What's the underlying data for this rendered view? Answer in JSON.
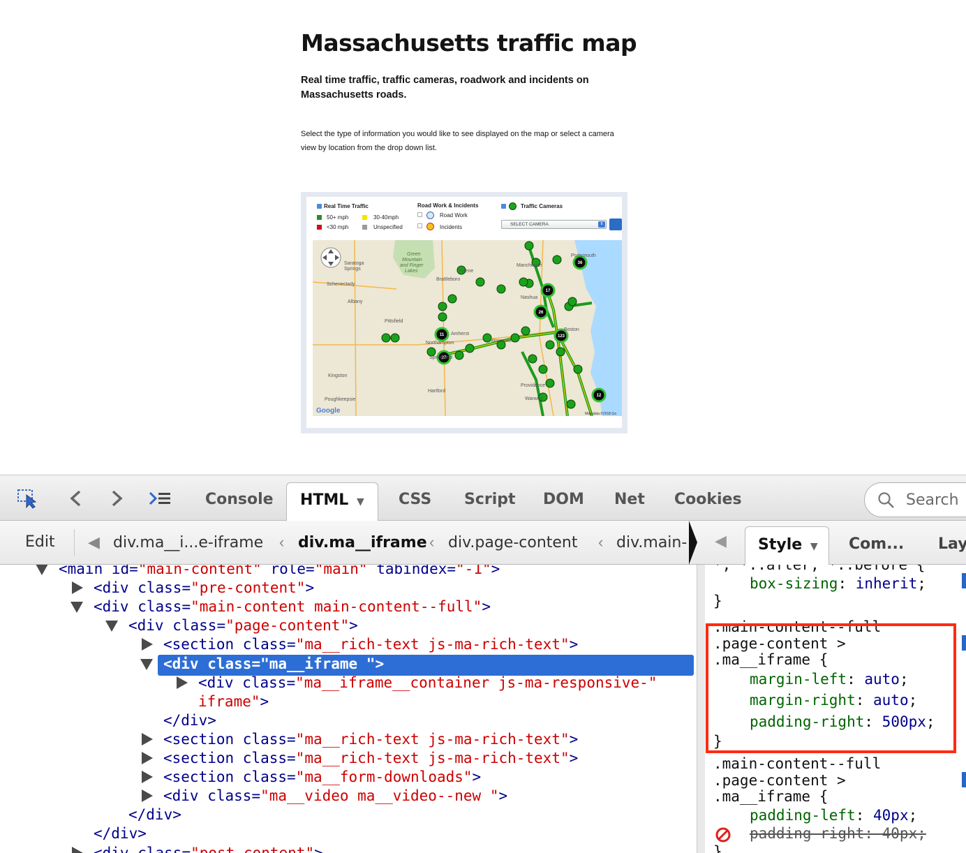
{
  "page": {
    "title": "Massachusetts traffic map",
    "lede": "Real time traffic, traffic cameras, roadwork and incidents on Massachusetts roads.",
    "help": "Select the type of information you would like to see displayed on the map or select a camera view by location from the drop down list."
  },
  "map_widget": {
    "legend": {
      "traffic_title": "Real Time Traffic",
      "speed_50": "50+ mph",
      "speed_30": "30-40mph",
      "speed_lt30": "<30 mph",
      "unspecified": "Unspecified",
      "road_title": "Road Work & Incidents",
      "road_work": "Road Work",
      "incidents": "Incidents",
      "cameras_title": "Traffic Cameras",
      "select_camera": "SELECT CAMERA"
    },
    "colors": {
      "green": "#2e8b2e",
      "yellow": "#f2e600",
      "red": "#cc1111",
      "gray": "#9a9a9a"
    },
    "places": [
      "Saratoga Springs",
      "Schenectady",
      "Albany",
      "Green Mountain and Finger Lakes",
      "Keene",
      "Brattleboro",
      "Manchester",
      "Portsmouth",
      "Nashua",
      "Pittsfield",
      "Amherst",
      "Northampton",
      "Worcester",
      "Springfield",
      "Boston",
      "Kingston",
      "Hartford",
      "Providence",
      "Warwick",
      "Poughkeepsie"
    ],
    "cluster_counts": [
      "36",
      "17",
      "26",
      "123",
      "11",
      "27",
      "12"
    ],
    "attribution": "Map data ©2018 Go",
    "logo": "Google"
  },
  "devtools": {
    "tabs": [
      "Console",
      "HTML",
      "CSS",
      "Script",
      "DOM",
      "Net",
      "Cookies"
    ],
    "active_tab": "HTML",
    "search_placeholder": "Search",
    "edit_label": "Edit",
    "breadcrumbs": [
      "div.ma__i...e-iframe",
      "div.ma__iframe",
      "div.page-content",
      "div.main-"
    ],
    "side_tabs": [
      "Style",
      "Com...",
      "Lay"
    ],
    "html_rows": [
      {
        "indent": 1,
        "twisty": "open",
        "tag": "main",
        "attrs": [
          [
            "id",
            "main-content"
          ],
          [
            "role",
            "main"
          ],
          [
            "tabindex",
            "-1"
          ]
        ],
        "close": ">"
      },
      {
        "indent": 2,
        "twisty": "closed",
        "tag": "div",
        "attrs": [
          [
            "class",
            "pre-content"
          ]
        ],
        "close": ">"
      },
      {
        "indent": 2,
        "twisty": "open",
        "tag": "div",
        "attrs": [
          [
            "class",
            "main-content main-content--full"
          ]
        ],
        "close": ">"
      },
      {
        "indent": 3,
        "twisty": "open",
        "tag": "div",
        "attrs": [
          [
            "class",
            "page-content"
          ]
        ],
        "close": ">"
      },
      {
        "indent": 4,
        "twisty": "closed",
        "tag": "section",
        "attrs": [
          [
            "class",
            "ma__rich-text js-ma-rich-text"
          ]
        ],
        "close": ">"
      },
      {
        "indent": 4,
        "twisty": "open",
        "tag": "div",
        "attrs": [
          [
            "class",
            "ma__iframe "
          ]
        ],
        "close": ">",
        "selected": true
      },
      {
        "indent": 5,
        "twisty": "closed",
        "tag": "div",
        "attrs": [
          [
            "class",
            "ma__iframe__container js-ma-responsive-"
          ]
        ],
        "close": ""
      },
      {
        "indent": 5,
        "twisty": "none",
        "raw_val": "iframe\"",
        "raw_tail": ">"
      },
      {
        "indent": 4,
        "twisty": "none",
        "endtag": "div"
      },
      {
        "indent": 4,
        "twisty": "closed",
        "tag": "section",
        "attrs": [
          [
            "class",
            "ma__rich-text js-ma-rich-text"
          ]
        ],
        "close": ">"
      },
      {
        "indent": 4,
        "twisty": "closed",
        "tag": "section",
        "attrs": [
          [
            "class",
            "ma__rich-text js-ma-rich-text"
          ]
        ],
        "close": ">"
      },
      {
        "indent": 4,
        "twisty": "closed",
        "tag": "section",
        "attrs": [
          [
            "class",
            "ma__form-downloads"
          ]
        ],
        "close": ">"
      },
      {
        "indent": 4,
        "twisty": "closed",
        "tag": "div",
        "attrs": [
          [
            "class",
            "ma__video ma__video--new "
          ]
        ],
        "close": ">"
      },
      {
        "indent": 3,
        "twisty": "none",
        "endtag": "div"
      },
      {
        "indent": 2,
        "twisty": "none",
        "endtag": "div"
      },
      {
        "indent": 2,
        "twisty": "closed",
        "tag": "div",
        "attrs": [
          [
            "class",
            "post-content"
          ]
        ],
        "close": ">"
      }
    ],
    "style_rules": [
      {
        "selector": [
          "*, *::after, *::before {"
        ],
        "decls": [
          [
            "box-sizing",
            "inherit",
            false
          ]
        ]
      },
      {
        "selector": [
          ".main-content--full",
          ".page-content >",
          ".ma__iframe {"
        ],
        "decls": [
          [
            "margin-left",
            "auto",
            false
          ],
          [
            "margin-right",
            "auto",
            false
          ],
          [
            "padding-right",
            "500px",
            false
          ]
        ],
        "highlighted": true
      },
      {
        "selector": [
          ".main-content--full",
          ".page-content >",
          ".ma__iframe {"
        ],
        "decls": [
          [
            "padding-left",
            "40px",
            false
          ],
          [
            "padding-right",
            "40px",
            true
          ]
        ]
      }
    ]
  }
}
